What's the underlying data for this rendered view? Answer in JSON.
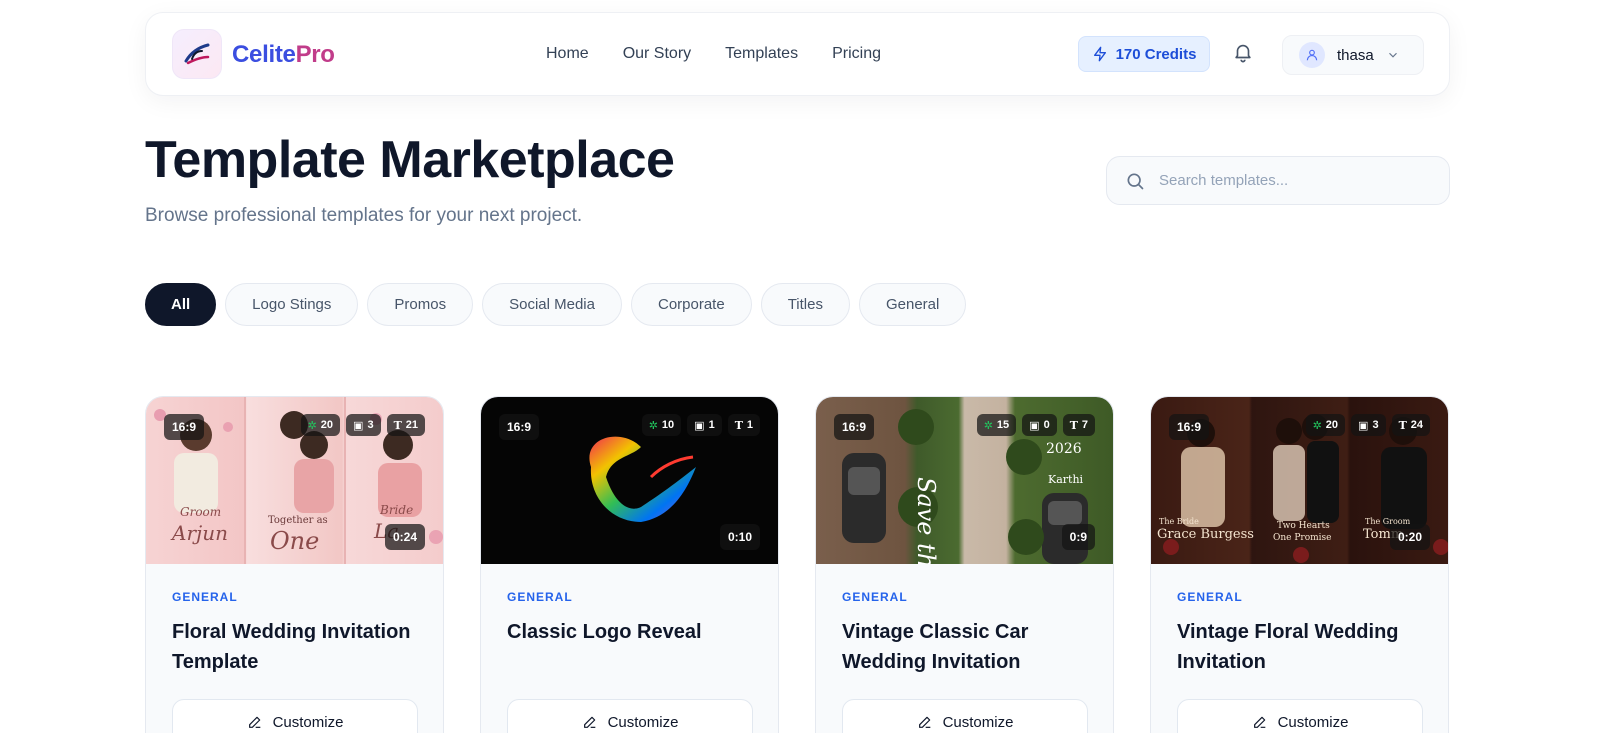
{
  "brand": {
    "part1": "Celite",
    "part2": "Pro"
  },
  "nav": [
    "Home",
    "Our Story",
    "Templates",
    "Pricing"
  ],
  "credits": "170 Credits",
  "user": {
    "name": "thasa"
  },
  "page": {
    "title": "Template Marketplace",
    "subtitle": "Browse professional templates for your next project."
  },
  "search": {
    "placeholder": "Search templates..."
  },
  "filters": [
    "All",
    "Logo Stings",
    "Promos",
    "Social Media",
    "Corporate",
    "Titles",
    "General"
  ],
  "cards": [
    {
      "ratio": "16:9",
      "layers": "20",
      "images": "3",
      "texts": "21",
      "duration": "0:24",
      "category": "GENERAL",
      "title": "Floral Wedding Invitation Template",
      "button": "Customize",
      "thumb_text": {
        "t1": "Groom",
        "t2": "Arjun",
        "t3": "Together as",
        "t4": "One",
        "t5": "Bride",
        "t6": "La"
      }
    },
    {
      "ratio": "16:9",
      "layers": "10",
      "images": "1",
      "texts": "1",
      "duration": "0:10",
      "category": "GENERAL",
      "title": "Classic Logo Reveal",
      "button": "Customize"
    },
    {
      "ratio": "16:9",
      "layers": "15",
      "images": "0",
      "texts": "7",
      "duration": "0:9",
      "category": "GENERAL",
      "title": "Vintage Classic Car Wedding Invitation",
      "button": "Customize",
      "thumb_text": {
        "t1": "Save the Date",
        "t2": "2026",
        "t3": "Karthi"
      }
    },
    {
      "ratio": "16:9",
      "layers": "20",
      "images": "3",
      "texts": "24",
      "duration": "0:20",
      "category": "GENERAL",
      "title": "Vintage Floral Wedding Invitation",
      "button": "Customize",
      "thumb_text": {
        "t1": "The Bride",
        "t2": "Grace Burgess",
        "t3": "Two Hearts",
        "t4": "One Promise",
        "t5": "The Groom",
        "t6": "Tomm"
      }
    }
  ],
  "icons": {
    "logo": "swoosh-logo-icon",
    "credits": "lightning-icon",
    "bell": "bell-icon",
    "avatar": "user-icon",
    "chevron": "chevron-down-icon",
    "search": "search-icon",
    "layers": "layers-icon",
    "image": "image-icon",
    "text": "text-icon",
    "edit": "pencil-icon"
  },
  "colors": {
    "accent": "#2563eb",
    "brand_blue": "#3b4ee0",
    "brand_pink": "#c13c8a",
    "dark": "#0f172a"
  }
}
